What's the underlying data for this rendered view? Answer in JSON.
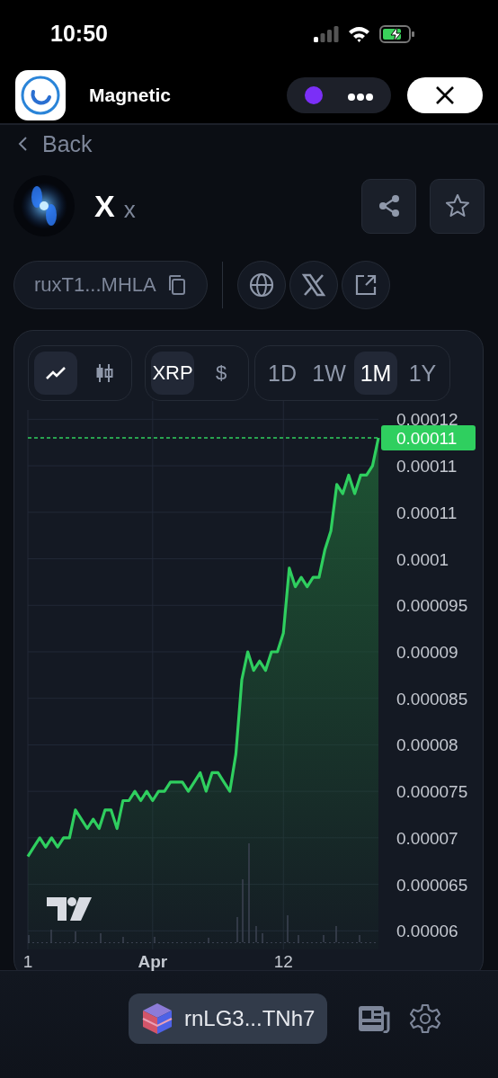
{
  "status_bar": {
    "time": "10:50"
  },
  "app_header": {
    "title": "Magnetic"
  },
  "back": {
    "label": "Back"
  },
  "token": {
    "name": "X",
    "symbol": "x",
    "address": "ruxT1...MHLA"
  },
  "chart_panel": {
    "price_badge": "0.00011",
    "chart_types": [
      {
        "kind": "line",
        "selected": true
      },
      {
        "kind": "candles",
        "selected": false
      }
    ],
    "currencies": [
      {
        "label": "XRP",
        "selected": true
      },
      {
        "label": "$",
        "selected": false
      }
    ],
    "ranges": [
      {
        "label": "1D",
        "selected": false
      },
      {
        "label": "1W",
        "selected": false
      },
      {
        "label": "1M",
        "selected": true
      },
      {
        "label": "1Y",
        "selected": false
      }
    ],
    "chart_data": {
      "type": "area",
      "categories": [
        "1",
        null,
        null,
        null,
        null,
        null,
        null,
        null,
        null,
        null,
        null,
        null,
        null,
        null,
        null,
        null,
        null,
        null,
        null,
        null,
        null,
        "Apr",
        null,
        null,
        null,
        null,
        null,
        null,
        null,
        null,
        null,
        null,
        null,
        null,
        null,
        null,
        null,
        null,
        null,
        null,
        null,
        null,
        null,
        "12",
        null,
        null,
        null,
        null,
        null,
        null,
        null,
        null,
        null,
        null,
        null,
        null,
        null,
        null,
        null,
        null
      ],
      "series": [
        {
          "color": "#2fcf5f",
          "values": [
            6.8e-05,
            6.9e-05,
            7e-05,
            6.9e-05,
            7e-05,
            6.9e-05,
            7e-05,
            7e-05,
            7.3e-05,
            7.2e-05,
            7.1e-05,
            7.2e-05,
            7.1e-05,
            7.3e-05,
            7.3e-05,
            7.1e-05,
            7.4e-05,
            7.4e-05,
            7.5e-05,
            7.4e-05,
            7.5e-05,
            7.4e-05,
            7.5e-05,
            7.5e-05,
            7.6e-05,
            7.6e-05,
            7.6e-05,
            7.5e-05,
            7.6e-05,
            7.7e-05,
            7.5e-05,
            7.7e-05,
            7.7e-05,
            7.6e-05,
            7.5e-05,
            7.9e-05,
            8.7e-05,
            9e-05,
            8.8e-05,
            8.9e-05,
            8.8e-05,
            9e-05,
            9e-05,
            9.2e-05,
            9.9e-05,
            9.7e-05,
            9.8e-05,
            9.7e-05,
            9.8e-05,
            9.8e-05,
            0.000101,
            0.000103,
            0.000108,
            0.000107,
            0.000109,
            0.000107,
            0.000109,
            0.000109,
            0.00011,
            0.000113
          ]
        }
      ],
      "ylim": [
        5.8e-05,
        0.000116
      ],
      "grid": true,
      "yticks": [
        {
          "value": 0.000115,
          "label": "0.00012"
        },
        {
          "value": 0.00011,
          "label": "0.00011"
        },
        {
          "value": 0.000105,
          "label": "0.00011"
        },
        {
          "value": 0.0001,
          "label": "0.0001"
        },
        {
          "value": 9.5e-05,
          "label": "0.000095"
        },
        {
          "value": 9e-05,
          "label": "0.00009"
        },
        {
          "value": 8.5e-05,
          "label": "0.000085"
        },
        {
          "value": 8e-05,
          "label": "0.00008"
        },
        {
          "value": 7.5e-05,
          "label": "0.000075"
        },
        {
          "value": 7e-05,
          "label": "0.00007"
        },
        {
          "value": 6.5e-05,
          "label": "0.000065"
        },
        {
          "value": 6e-05,
          "label": "0.00006"
        }
      ]
    }
  },
  "wallet": {
    "address": "rnLG3...TNh7"
  }
}
